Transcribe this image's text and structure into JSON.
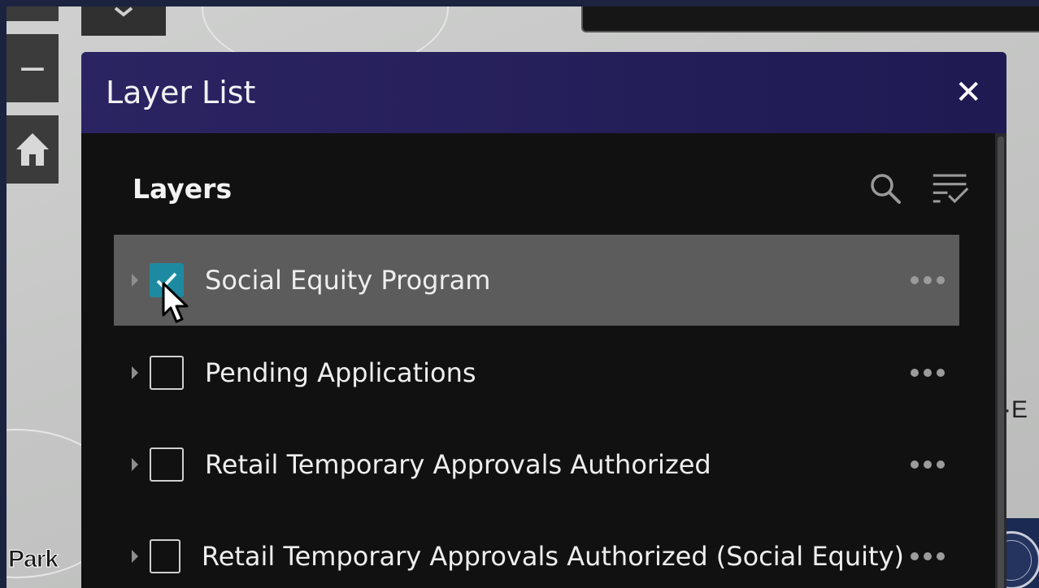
{
  "map": {
    "park_label": "Park",
    "right_label": "·E",
    "zoom_out_glyph": "−",
    "home_icon": "home-icon"
  },
  "panel": {
    "title": "Layer List",
    "close_glyph": "✕",
    "accent_color": "#2b2462"
  },
  "layers_section": {
    "title": "Layers",
    "tools": [
      "search-icon",
      "filter-check-icon"
    ]
  },
  "layers": [
    {
      "label": "Social Equity Program",
      "checked": true,
      "selected": true
    },
    {
      "label": "Pending Applications",
      "checked": false,
      "selected": false
    },
    {
      "label": "Retail Temporary Approvals Authorized",
      "checked": false,
      "selected": false
    },
    {
      "label": "Retail Temporary Approvals Authorized (Social Equity)",
      "checked": false,
      "selected": false
    }
  ],
  "checkbox_color": "#1d8aa2"
}
